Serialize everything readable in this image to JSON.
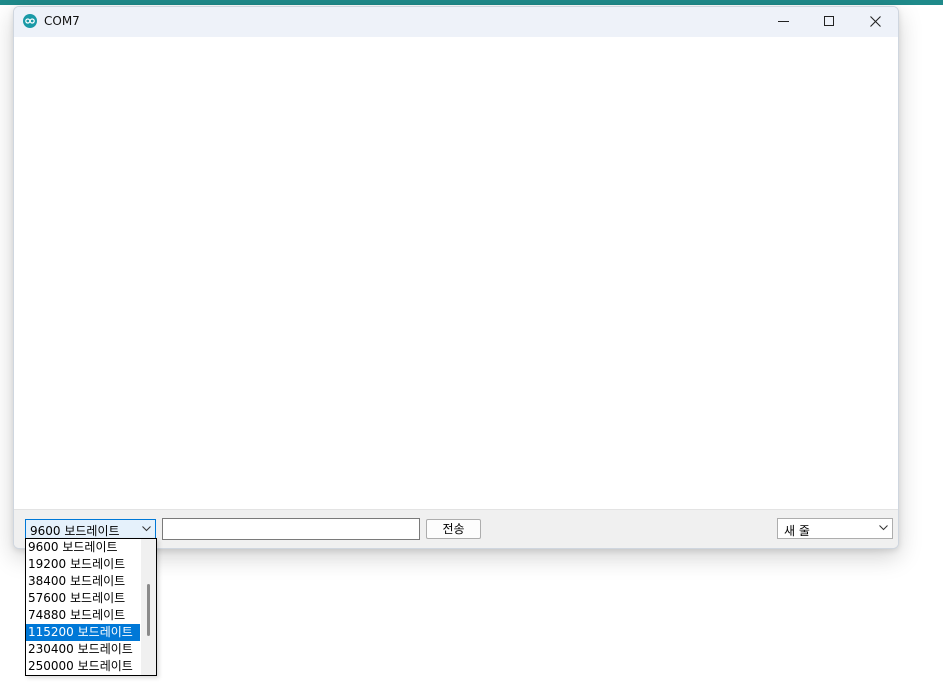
{
  "window": {
    "title": "COM7",
    "app_icon": "arduino-infinity-icon",
    "controls": [
      "minimize-icon",
      "maximize-icon",
      "close-icon"
    ]
  },
  "output": {
    "text": ""
  },
  "bottom_bar": {
    "baud_select": {
      "value": "9600 보드레이트",
      "icon": "chevron-down-icon"
    },
    "message_input": {
      "value": "",
      "placeholder": ""
    },
    "send_button": {
      "label": "전송"
    },
    "line_ending_select": {
      "value": "새 줄",
      "icon": "chevron-down-icon"
    }
  },
  "baud_dropdown": {
    "items": [
      "9600 보드레이트",
      "19200 보드레이트",
      "38400 보드레이트",
      "57600 보드레이트",
      "74880 보드레이트",
      "115200 보드레이트",
      "230400 보드레이트",
      "250000 보드레이트"
    ],
    "highlighted": "115200 보드레이트",
    "scroll_position": 0.4
  },
  "colors": {
    "accent": "#0078d7",
    "titlebar": "#eef2f9",
    "app_icon": "#1a9aa7",
    "top_strip": "#1f8a8a"
  }
}
